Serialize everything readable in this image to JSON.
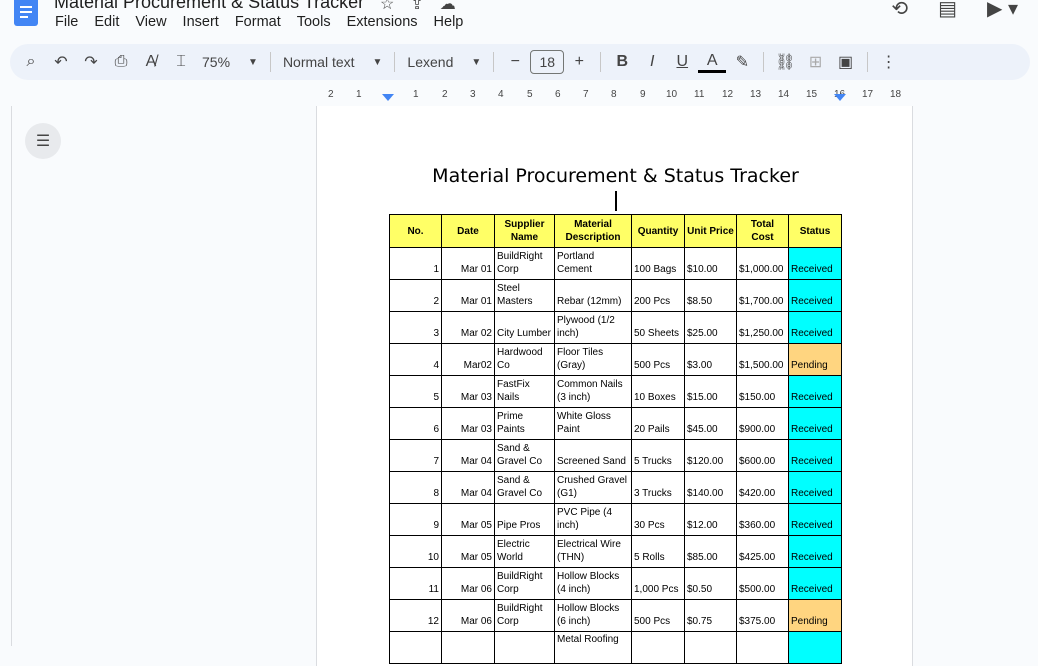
{
  "app": {
    "doc_title": "Material Procurement & Status Tracker",
    "menu": [
      "File",
      "Edit",
      "View",
      "Insert",
      "Format",
      "Tools",
      "Extensions",
      "Help"
    ]
  },
  "toolbar": {
    "zoom": "75%",
    "style": "Normal text",
    "font": "Lexend",
    "font_size": "18",
    "minus": "−",
    "plus": "+",
    "bold": "B",
    "italic": "I",
    "underline": "U",
    "text_color": "A"
  },
  "ruler": [
    "2",
    "1",
    "1",
    "2",
    "3",
    "4",
    "5",
    "6",
    "7",
    "8",
    "9",
    "10",
    "11",
    "12",
    "13",
    "14",
    "15",
    "16",
    "17",
    "18"
  ],
  "page": {
    "title": "Material Procurement & Status Tracker"
  },
  "table": {
    "headers": [
      "No.",
      "Date",
      "Supplier Name",
      "Material Description",
      "Quantity",
      "Unit Price",
      "Total Cost",
      "Status"
    ],
    "rows": [
      {
        "no": "1",
        "date": "Mar 01",
        "supplier": "BuildRight Corp",
        "material": "Portland Cement",
        "qty": "100 Bags",
        "unit": "$10.00",
        "total": "$1,000.00",
        "status": "Received"
      },
      {
        "no": "2",
        "date": "Mar 01",
        "supplier": "Steel Masters",
        "material": "Rebar (12mm)",
        "qty": "200 Pcs",
        "unit": "$8.50",
        "total": "$1,700.00",
        "status": "Received"
      },
      {
        "no": "3",
        "date": "Mar 02",
        "supplier": "City Lumber",
        "material": "Plywood (1/2 inch)",
        "qty": "50 Sheets",
        "unit": "$25.00",
        "total": "$1,250.00",
        "status": "Received"
      },
      {
        "no": "4",
        "date": "Mar02",
        "supplier": "Hardwood Co",
        "material": "Floor Tiles (Gray)",
        "qty": "500 Pcs",
        "unit": "$3.00",
        "total": "$1,500.00",
        "status": "Pending"
      },
      {
        "no": "5",
        "date": "Mar 03",
        "supplier": "FastFix Nails",
        "material": "Common Nails (3 inch)",
        "qty": "10 Boxes",
        "unit": "$15.00",
        "total": "$150.00",
        "status": "Received"
      },
      {
        "no": "6",
        "date": "Mar 03",
        "supplier": "Prime Paints",
        "material": "White Gloss Paint",
        "qty": "20 Pails",
        "unit": "$45.00",
        "total": "$900.00",
        "status": "Received"
      },
      {
        "no": "7",
        "date": "Mar 04",
        "supplier": "Sand & Gravel Co",
        "material": "Screened Sand",
        "qty": "5 Trucks",
        "unit": "$120.00",
        "total": "$600.00",
        "status": "Received"
      },
      {
        "no": "8",
        "date": "Mar 04",
        "supplier": "Sand & Gravel Co",
        "material": "Crushed Gravel (G1)",
        "qty": "3 Trucks",
        "unit": "$140.00",
        "total": "$420.00",
        "status": "Received"
      },
      {
        "no": "9",
        "date": "Mar 05",
        "supplier": "Pipe Pros",
        "material": "PVC Pipe (4 inch)",
        "qty": "30 Pcs",
        "unit": "$12.00",
        "total": "$360.00",
        "status": "Received"
      },
      {
        "no": "10",
        "date": "Mar 05",
        "supplier": "Electric World",
        "material": "Electrical Wire (THN)",
        "qty": "5 Rolls",
        "unit": "$85.00",
        "total": "$425.00",
        "status": "Received"
      },
      {
        "no": "11",
        "date": "Mar 06",
        "supplier": "BuildRight Corp",
        "material": "Hollow Blocks (4 inch)",
        "qty": "1,000 Pcs",
        "unit": "$0.50",
        "total": "$500.00",
        "status": "Received"
      },
      {
        "no": "12",
        "date": "Mar 06",
        "supplier": "BuildRight Corp",
        "material": "Hollow Blocks (6 inch)",
        "qty": "500 Pcs",
        "unit": "$0.75",
        "total": "$375.00",
        "status": "Pending"
      },
      {
        "no": "",
        "date": "",
        "supplier": "",
        "material": "Metal Roofing",
        "qty": "",
        "unit": "",
        "total": "",
        "status": ""
      }
    ]
  },
  "colors": {
    "header_fill": "#ffff66",
    "received_fill": "#00ffff",
    "pending_fill": "#ffd580"
  }
}
